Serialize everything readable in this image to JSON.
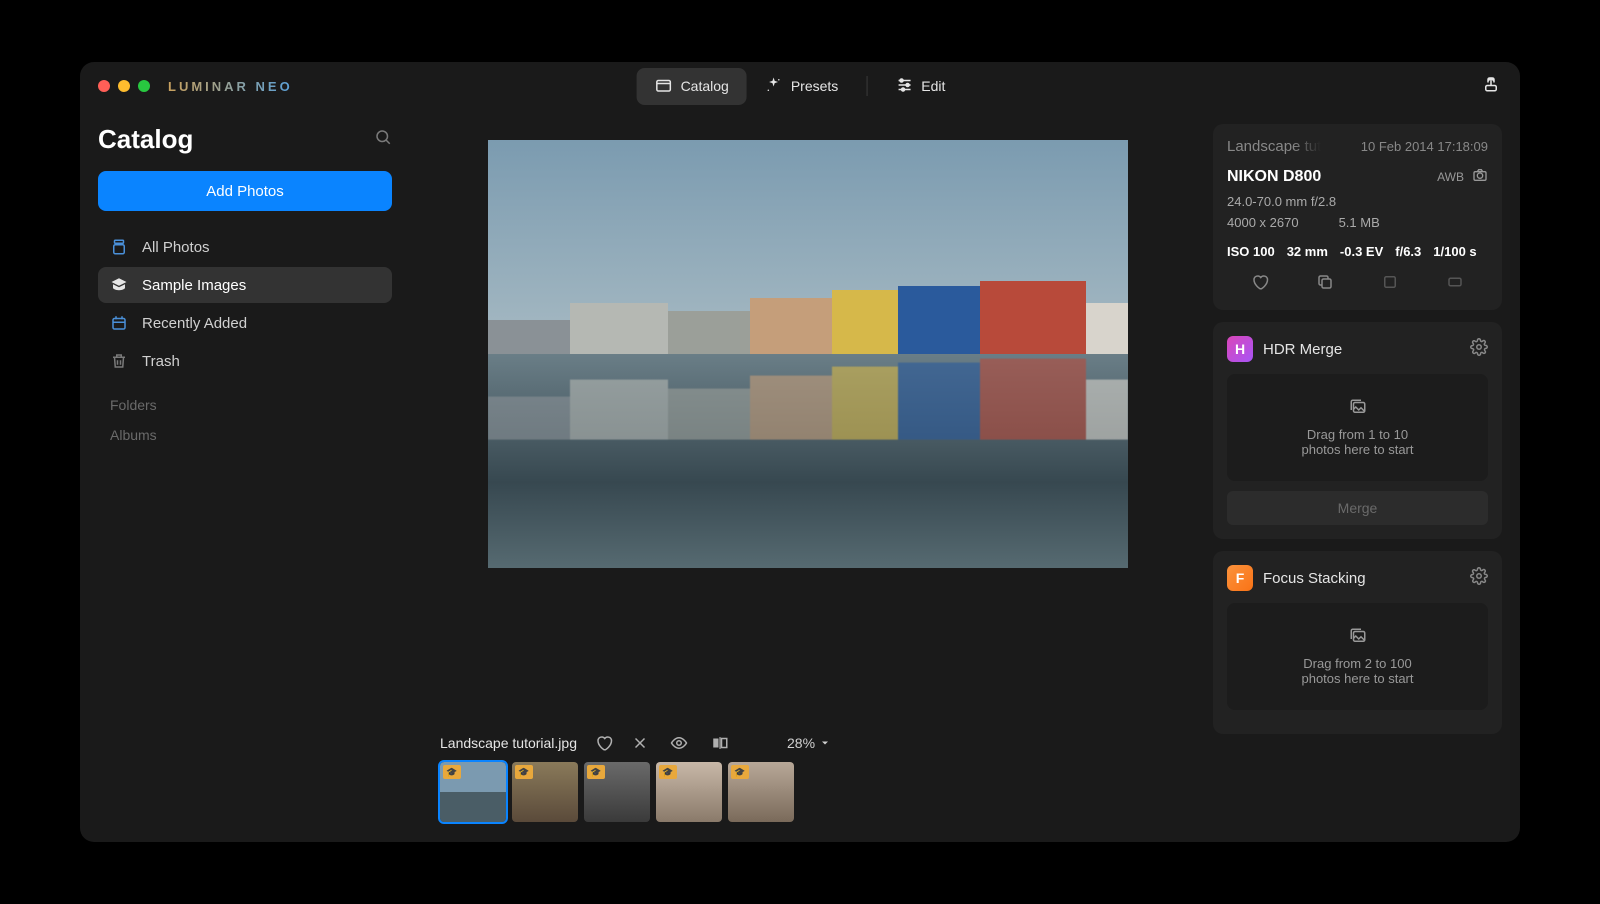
{
  "app": {
    "logo": "LUMINAR NEO"
  },
  "tabs": {
    "catalog": "Catalog",
    "presets": "Presets",
    "edit": "Edit"
  },
  "sidebar": {
    "title": "Catalog",
    "add_button": "Add Photos",
    "items": [
      {
        "label": "All Photos"
      },
      {
        "label": "Sample Images"
      },
      {
        "label": "Recently Added"
      },
      {
        "label": "Trash"
      }
    ],
    "sections": {
      "folders": "Folders",
      "albums": "Albums"
    }
  },
  "strip": {
    "filename": "Landscape tutorial.jpg",
    "zoom": "28%"
  },
  "meta": {
    "name": "Landscape tut",
    "datetime": "10 Feb 2014 17:18:09",
    "camera": "NIKON D800",
    "awb": "AWB",
    "lens": "24.0-70.0 mm f/2.8",
    "dimensions": "4000 x 2670",
    "filesize": "5.1 MB",
    "exif": {
      "iso": "ISO 100",
      "focal": "32 mm",
      "ev": "-0.3 EV",
      "aperture": "f/6.3",
      "shutter": "1/100 s"
    }
  },
  "tools": {
    "hdr": {
      "title": "HDR Merge",
      "drop_l1": "Drag from 1 to 10",
      "drop_l2": "photos here to start",
      "button": "Merge"
    },
    "focus": {
      "title": "Focus Stacking",
      "drop_l1": "Drag from 2 to 100",
      "drop_l2": "photos here to start"
    }
  }
}
